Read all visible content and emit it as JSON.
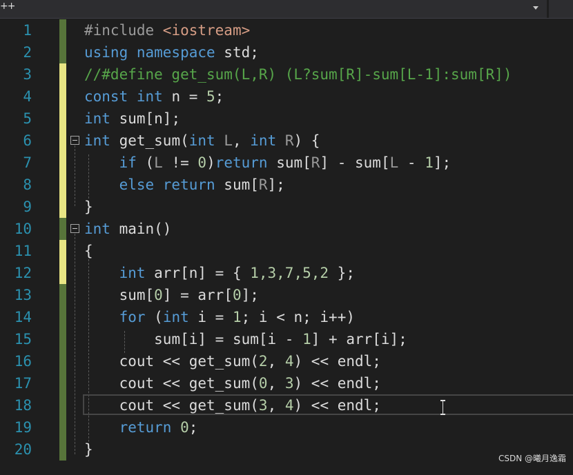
{
  "topbar": {
    "tab_fragment": "++"
  },
  "line_numbers": [
    "1",
    "2",
    "3",
    "4",
    "5",
    "6",
    "7",
    "8",
    "9",
    "10",
    "11",
    "12",
    "13",
    "14",
    "15",
    "16",
    "17",
    "18",
    "19",
    "20"
  ],
  "code": {
    "l1": {
      "pp": "#include ",
      "str": "<iostream>"
    },
    "l2": {
      "kw": "using namespace",
      "rest": " std;"
    },
    "l3": {
      "cm": "//#define get_sum(L,R) (L?sum[R]-sum[L-1]:sum[R])"
    },
    "l4": {
      "kw": "const int",
      "rest1": " n = ",
      "num": "5",
      "rest2": ";"
    },
    "l5": {
      "kw": "int",
      "rest": " sum[n];"
    },
    "l6": {
      "kw1": "int",
      "fn": " get_sum",
      "p1": "(",
      "kw2": "int",
      "param1": " L",
      "p2": ", ",
      "kw3": "int",
      "param2": " R",
      "p3": ") {"
    },
    "l7": {
      "indent": "    ",
      "kw1": "if",
      "p1": " (",
      "param1": "L",
      "p2": " != ",
      "num": "0",
      "p3": ")",
      "kw2": "return",
      "p4": " sum[",
      "param2": "R",
      "p5": "] - sum[",
      "param3": "L",
      "p6": " - ",
      "num2": "1",
      "p7": "];"
    },
    "l8": {
      "indent": "    ",
      "kw": "else return",
      "p1": " sum[",
      "param": "R",
      "p2": "];"
    },
    "l9": {
      "text": "}"
    },
    "l10": {
      "kw": "int",
      "rest": " main()"
    },
    "l11": {
      "text": "{"
    },
    "l12": {
      "indent": "    ",
      "kw": "int",
      "p1": " arr[n] = { ",
      "num": "1,3,7,5,2",
      "p2": " };"
    },
    "l13": {
      "indent": "    ",
      "p1": "sum[",
      "num1": "0",
      "p2": "] = arr[",
      "num2": "0",
      "p3": "];"
    },
    "l14": {
      "indent": "    ",
      "kw1": "for",
      "p1": " (",
      "kw2": "int",
      "p2": " i = ",
      "num": "1",
      "p3": "; i < n; i++)"
    },
    "l15": {
      "indent": "        ",
      "p1": "sum[i] = sum[i - ",
      "num": "1",
      "p2": "] + arr[i];"
    },
    "l16": {
      "indent": "    ",
      "p1": "cout << ",
      "fn": "get_sum",
      "p2": "(",
      "n1": "2",
      "p3": ", ",
      "n2": "4",
      "p4": ") << endl;"
    },
    "l17": {
      "indent": "    ",
      "p1": "cout << ",
      "fn": "get_sum",
      "p2": "(",
      "n1": "0",
      "p3": ", ",
      "n2": "3",
      "p4": ") << endl;"
    },
    "l18": {
      "indent": "    ",
      "p1": "cout << ",
      "fn": "get_sum",
      "p2": "(",
      "n1": "3",
      "p3": ", ",
      "n2": "4",
      "p4": ") << endl;"
    },
    "l19": {
      "indent": "    ",
      "kw": "return",
      "p1": " ",
      "num": "0",
      "p2": ";"
    },
    "l20": {
      "text": "}"
    }
  },
  "watermark": "CSDN @曦月逸霜",
  "colors": {
    "background": "#1e1e1e",
    "line_number": "#2b91af",
    "keyword": "#569cd6",
    "comment": "#57a64a",
    "string": "#d69d85",
    "number": "#b5cea8",
    "function": "#dcdcaa",
    "change_saved": "#57743a",
    "change_unsaved": "#e8e584"
  }
}
